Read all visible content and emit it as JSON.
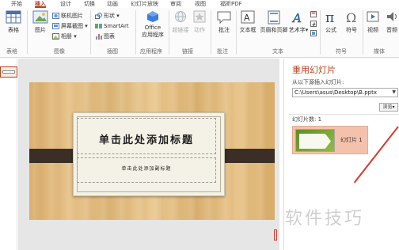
{
  "ribbon_tabs": {
    "items": [
      "开始",
      "插入",
      "设计",
      "切换",
      "动画",
      "幻灯片放映",
      "审阅",
      "视图",
      "福昕PDF"
    ],
    "active": "插入"
  },
  "ribbon": {
    "table": "表格",
    "picture": "图片",
    "online_picture": "联机图片",
    "screenshot": "屏幕截图",
    "album": "相册",
    "shapes": "形状",
    "smartart": "SmartArt",
    "chart": "图表",
    "office_apps_line1": "Office",
    "office_apps_line2": "应用程序",
    "hyperlink": "超链接",
    "action": "动作",
    "comment": "批注",
    "textbox": "文本框",
    "header_footer": "页眉和页脚",
    "wordart": "艺术字",
    "formula": "公式",
    "symbol": "符号",
    "video": "视频",
    "audio": "音频",
    "groups": {
      "tables": "表格",
      "images": "图像",
      "illustrations": "插图",
      "apps": "应用程序",
      "links": "链接",
      "comments": "批注",
      "text": "文本",
      "symbols": "符号",
      "media": "媒体"
    },
    "accent_color": "#c43e1c"
  },
  "slide": {
    "title": "单击此处添加标题",
    "subtitle": "单击此处添加副标题"
  },
  "reuse_panel": {
    "title": "重用幻灯片",
    "from_label": "从以下源插入幻灯片:",
    "path": "C:\\Users\\asus\\Desktop\\B.pptx",
    "browse": "浏览",
    "slides_count": "幻灯片数: 1",
    "slide_item": "幻灯片 1"
  },
  "watermark": "软件技巧"
}
